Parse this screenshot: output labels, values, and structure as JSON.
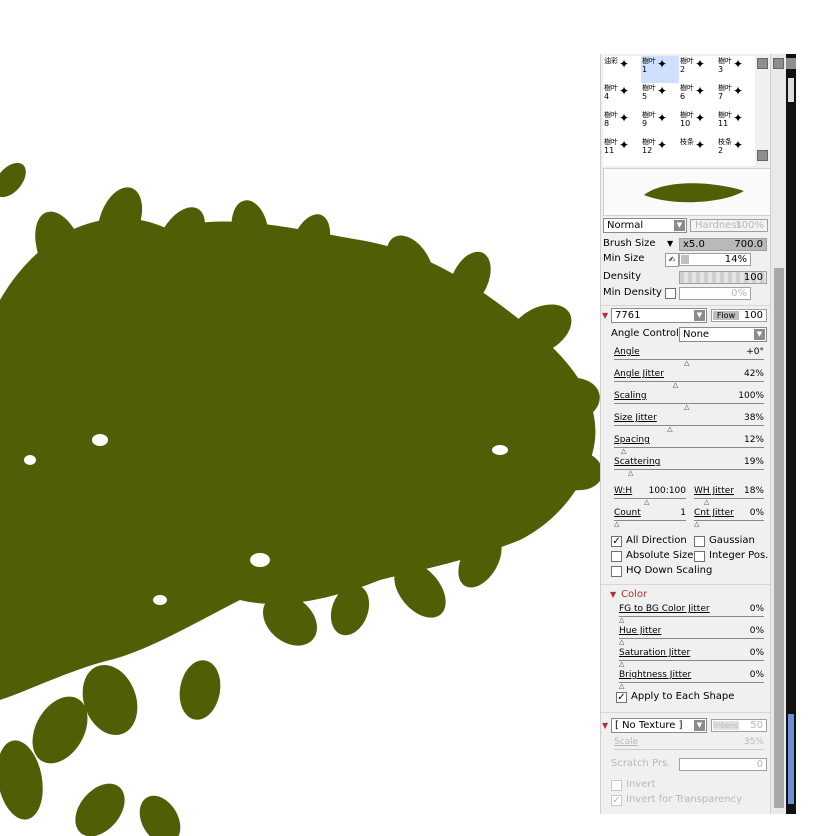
{
  "brush_grid": {
    "cells": [
      {
        "name": "油彩",
        "num": "",
        "icon": "✦"
      },
      {
        "name": "樹叶",
        "num": "1",
        "icon": "✦"
      },
      {
        "name": "樹叶",
        "num": "2",
        "icon": "✦"
      },
      {
        "name": "樹叶",
        "num": "3",
        "icon": "✦"
      },
      {
        "name": "樹叶",
        "num": "4",
        "icon": "✦"
      },
      {
        "name": "樹叶",
        "num": "5",
        "icon": "✦"
      },
      {
        "name": "樹叶",
        "num": "6",
        "icon": "✦"
      },
      {
        "name": "樹叶",
        "num": "7",
        "icon": "✦"
      },
      {
        "name": "樹叶",
        "num": "8",
        "icon": "✦"
      },
      {
        "name": "樹叶",
        "num": "9",
        "icon": "✦"
      },
      {
        "name": "樹叶",
        "num": "10",
        "icon": "✦"
      },
      {
        "name": "樹叶",
        "num": "11",
        "icon": "✦"
      },
      {
        "name": "樹叶",
        "num": "11",
        "icon": "✦"
      },
      {
        "name": "樹叶",
        "num": "12",
        "icon": "✦"
      },
      {
        "name": "枝条",
        "num": "",
        "icon": "✦"
      },
      {
        "name": "枝条",
        "num": "2",
        "icon": "✦"
      }
    ]
  },
  "blend": {
    "mode": "Normal",
    "hardness_label": "Hardness",
    "hardness_value": "100%"
  },
  "brush_size": {
    "label": "Brush Size",
    "multiplier": "x5.0",
    "value": "700.0"
  },
  "min_size": {
    "label": "Min Size",
    "value": "14%"
  },
  "density": {
    "label": "Density",
    "value": "100"
  },
  "min_density": {
    "label": "Min Density",
    "value": "0%"
  },
  "shape": {
    "name": "7761",
    "flow_label": "Flow",
    "flow_value": "100"
  },
  "angle_control": {
    "label": "Angle Control",
    "value": "None"
  },
  "sliders": [
    {
      "label": "Angle",
      "value": "+0°",
      "knob": 0.5
    },
    {
      "label": "Angle Jitter",
      "value": "42%",
      "knob": 0.42
    },
    {
      "label": "Scaling",
      "value": "100%",
      "knob": 0.5
    },
    {
      "label": "Size Jitter",
      "value": "38%",
      "knob": 0.38
    },
    {
      "label": "Spacing",
      "value": "12%",
      "knob": 0.05
    },
    {
      "label": "Scattering",
      "value": "19%",
      "knob": 0.1
    }
  ],
  "wh": {
    "label": "W:H",
    "value": "100:100",
    "jitter_label": "WH Jitter",
    "jitter_value": "18%"
  },
  "count": {
    "label": "Count",
    "value": "1",
    "jitter_label": "Cnt Jitter",
    "jitter_value": "0%"
  },
  "checks": {
    "all_direction": "All Direction",
    "gaussian": "Gaussian",
    "absolute_size": "Absolute Size",
    "integer_pos": "Integer Pos.",
    "hq_down_scaling": "HQ Down Scaling"
  },
  "color_section": {
    "title": "Color",
    "sliders": [
      {
        "label": "FG to BG Color Jitter",
        "value": "0%"
      },
      {
        "label": "Hue Jitter",
        "value": "0%"
      },
      {
        "label": "Saturation Jitter",
        "value": "0%"
      },
      {
        "label": "Brightness Jitter",
        "value": "0%"
      }
    ],
    "apply_each": "Apply to Each Shape"
  },
  "texture": {
    "name": "[ No Texture ]",
    "intens_label": "Intens",
    "intens_value": "50",
    "scale_label": "Scale",
    "scale_value": "35%",
    "scratch_label": "Scratch Prs.",
    "scratch_value": "0",
    "invert": "Invert",
    "invert_transparency": "Invert for Transparency"
  },
  "colors": {
    "foliage": "#4f5f06",
    "panel": "#f0f0f0",
    "accent": "#8aa2d8"
  }
}
